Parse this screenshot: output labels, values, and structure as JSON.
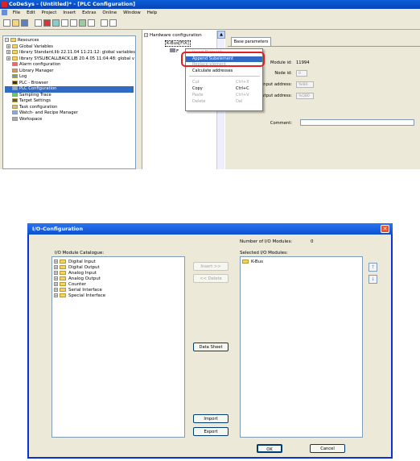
{
  "app": {
    "title": "CoDeSys - (Untitled)* - [PLC Configuration]",
    "menu": [
      "File",
      "Edit",
      "Project",
      "Insert",
      "Extras",
      "Online",
      "Window",
      "Help"
    ]
  },
  "tree": {
    "items": [
      {
        "label": "Resources",
        "expander": "−"
      },
      {
        "label": "Global Variables",
        "expander": "+"
      },
      {
        "label": "library Standard.lib 22.11.04 11:21:12: global variables",
        "expander": "+"
      },
      {
        "label": "library SYSLIBCALLBACK.LIB 20.4.05 11:04:48: global v",
        "expander": "+"
      },
      {
        "label": "Alarm configuration",
        "expander": ""
      },
      {
        "label": "Library Manager",
        "expander": ""
      },
      {
        "label": "Log",
        "expander": ""
      },
      {
        "label": "PLC - Browser",
        "expander": ""
      },
      {
        "label": "PLC Configuration",
        "expander": ""
      },
      {
        "label": "Sampling Trace",
        "expander": ""
      },
      {
        "label": "Target Settings",
        "expander": ""
      },
      {
        "label": "Task configuration",
        "expander": ""
      },
      {
        "label": "Watch- and Recipe Manager",
        "expander": ""
      },
      {
        "label": "Workspace",
        "expander": ""
      }
    ],
    "selected_index": 8
  },
  "hardware": {
    "root": "Hardware configuration",
    "child": "K-Bus[FIX]",
    "grandchild": "F"
  },
  "context_menu": {
    "items": [
      {
        "label": "Insert Element",
        "shortcut": "",
        "state": "disabled"
      },
      {
        "label": "Append Subelement",
        "shortcut": "",
        "state": "highlighted"
      },
      {
        "label": "Replace element",
        "shortcut": "",
        "state": "disabled"
      },
      {
        "label": "Calculate addresses",
        "shortcut": "",
        "state": "normal"
      },
      {
        "label": "Cut",
        "shortcut": "Ctrl+X",
        "state": "disabled"
      },
      {
        "label": "Copy",
        "shortcut": "Ctrl+C",
        "state": "normal"
      },
      {
        "label": "Paste",
        "shortcut": "Ctrl+V",
        "state": "disabled"
      },
      {
        "label": "Delete",
        "shortcut": "Del",
        "state": "disabled"
      }
    ]
  },
  "properties": {
    "tab": "Base parameters",
    "module_id_label": "Module id:",
    "module_id": "11994",
    "node_id_label": "Node id:",
    "node_id": "0",
    "input_address_label": "Input address:",
    "input_address": "%IB0",
    "output_address_label": "Output address:",
    "output_address": "%QB0",
    "comment_label": "Comment:",
    "comment": ""
  },
  "io_dialog": {
    "title": "I/O-Configuration",
    "count_label": "Number of I/O Modules:",
    "count": "0",
    "catalogue_label": "I/O Module Catalogue:",
    "selected_label": "Selected I/O Modules:",
    "catalogue": [
      "Digital Input",
      "Digital Output",
      "Analog Input",
      "Analog Output",
      "Counter",
      "Serial Interface",
      "Special Interface"
    ],
    "selected": [
      "K-Bus"
    ],
    "insert_button": "Insert >>",
    "delete_button": "<< Delete",
    "datasheet_button": "Data Sheet",
    "import_button": "Import",
    "export_button": "Export",
    "ok_button": "OK",
    "cancel_button": "Cancel",
    "move_up": "↑",
    "move_down": "↓",
    "close_glyph": "✕"
  }
}
